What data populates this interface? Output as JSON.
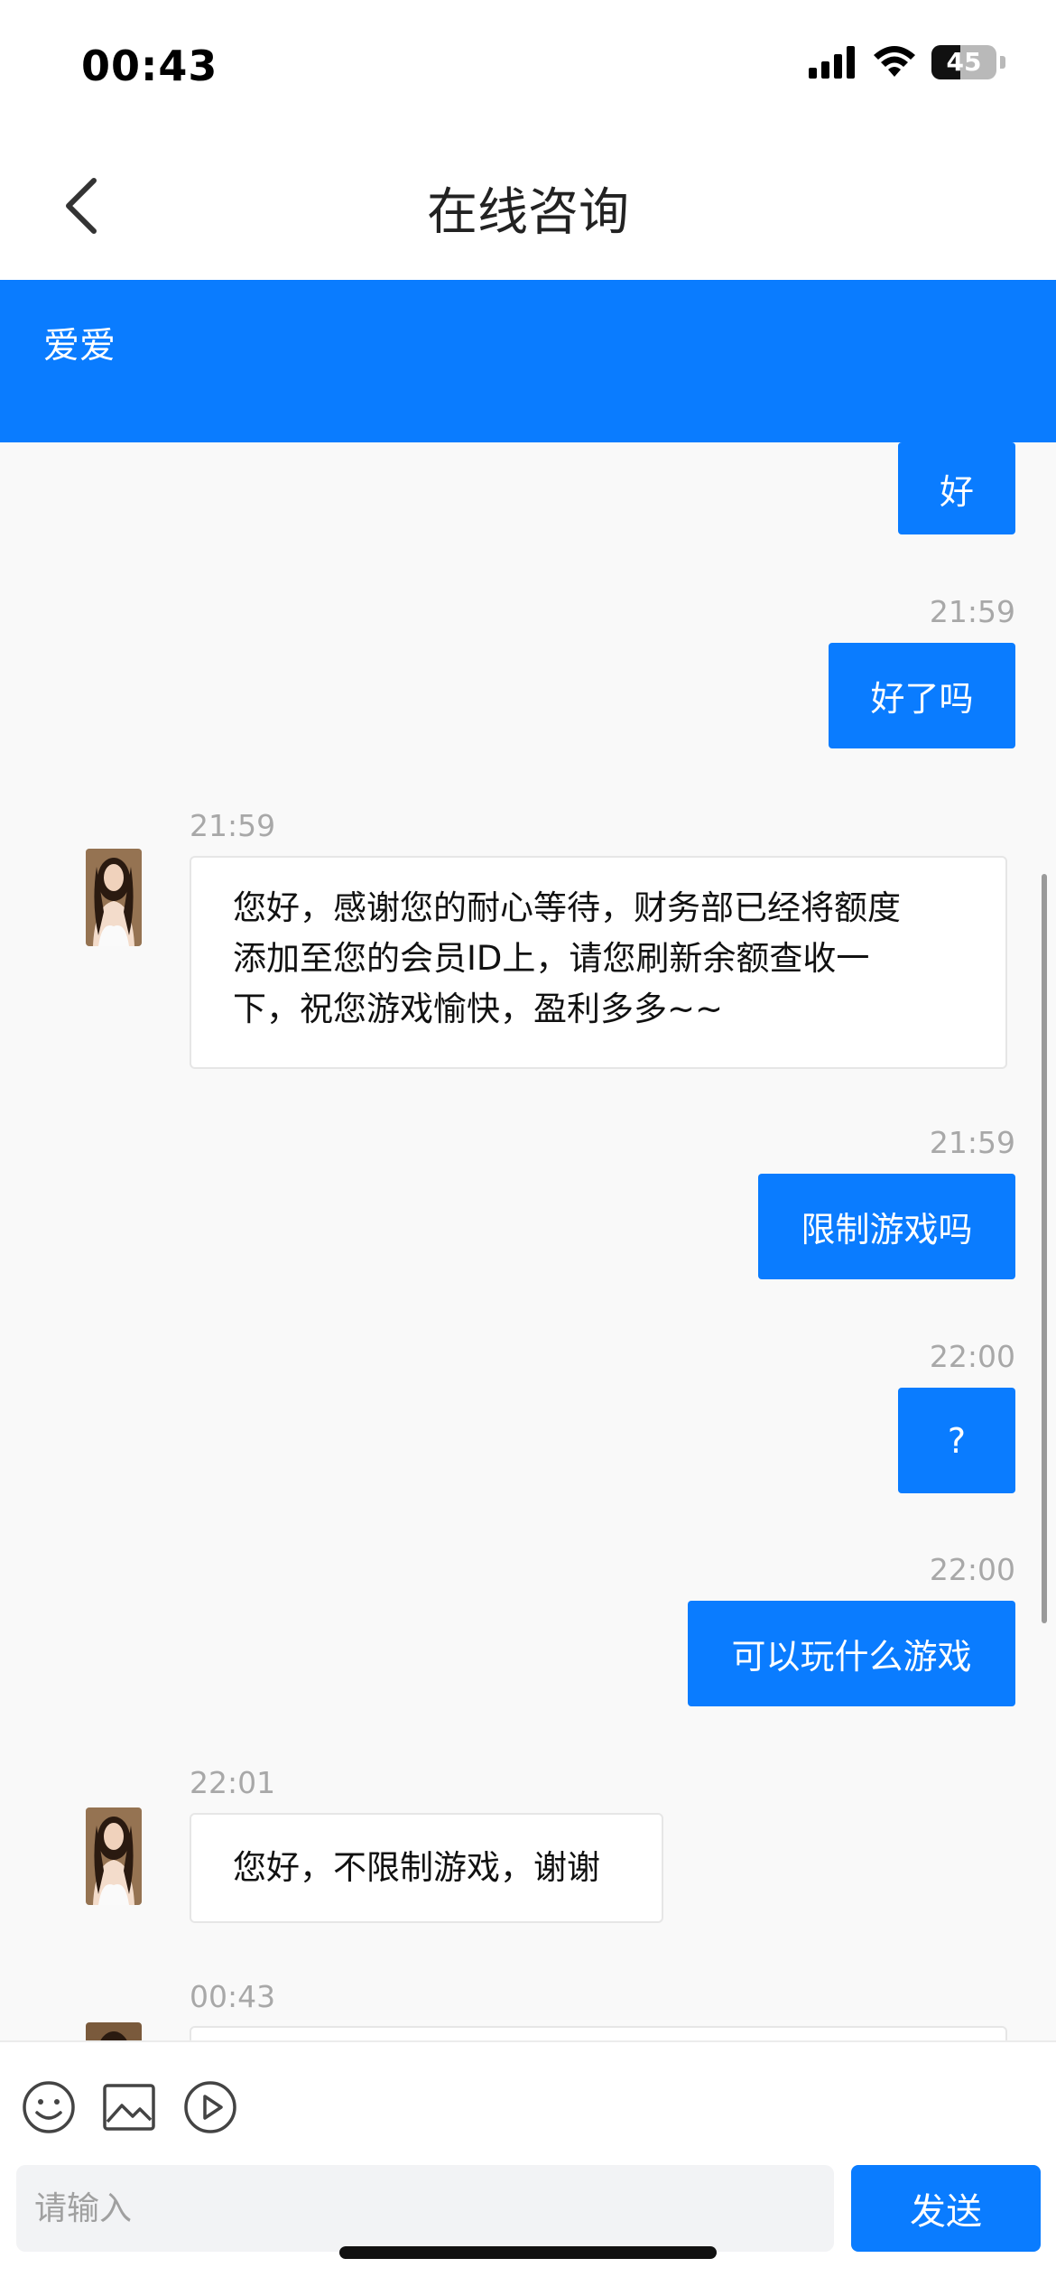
{
  "status_bar": {
    "time": "00:43",
    "battery": "45",
    "battery_level": 0.45
  },
  "nav": {
    "title": "在线咨询"
  },
  "agent": {
    "name": "爱爱"
  },
  "messages": [
    {
      "side": "out",
      "text": "好"
    },
    {
      "side": "out",
      "time": "21:59",
      "text": "好了吗"
    },
    {
      "side": "in",
      "time": "21:59",
      "lines": [
        "您好，感谢您的耐心等待，财务部已经将额度",
        "添加至您的会员ID上，请您刷新余额查收一",
        "下，祝您游戏愉快，盈利多多~~"
      ]
    },
    {
      "side": "out",
      "time": "21:59",
      "text": "限制游戏吗"
    },
    {
      "side": "out",
      "time": "22:00",
      "text": "?"
    },
    {
      "side": "out",
      "time": "22:00",
      "text": "可以玩什么游戏"
    },
    {
      "side": "in",
      "time": "22:01",
      "lines": [
        "您好，不限制游戏，谢谢"
      ]
    },
    {
      "side": "in",
      "time": "00:43",
      "lines": []
    }
  ],
  "toolbar": {
    "emoji": "smiley-icon",
    "image": "image-icon",
    "video": "play-circle-icon"
  },
  "input": {
    "placeholder": "请输入",
    "value": ""
  },
  "send_label": "发送"
}
